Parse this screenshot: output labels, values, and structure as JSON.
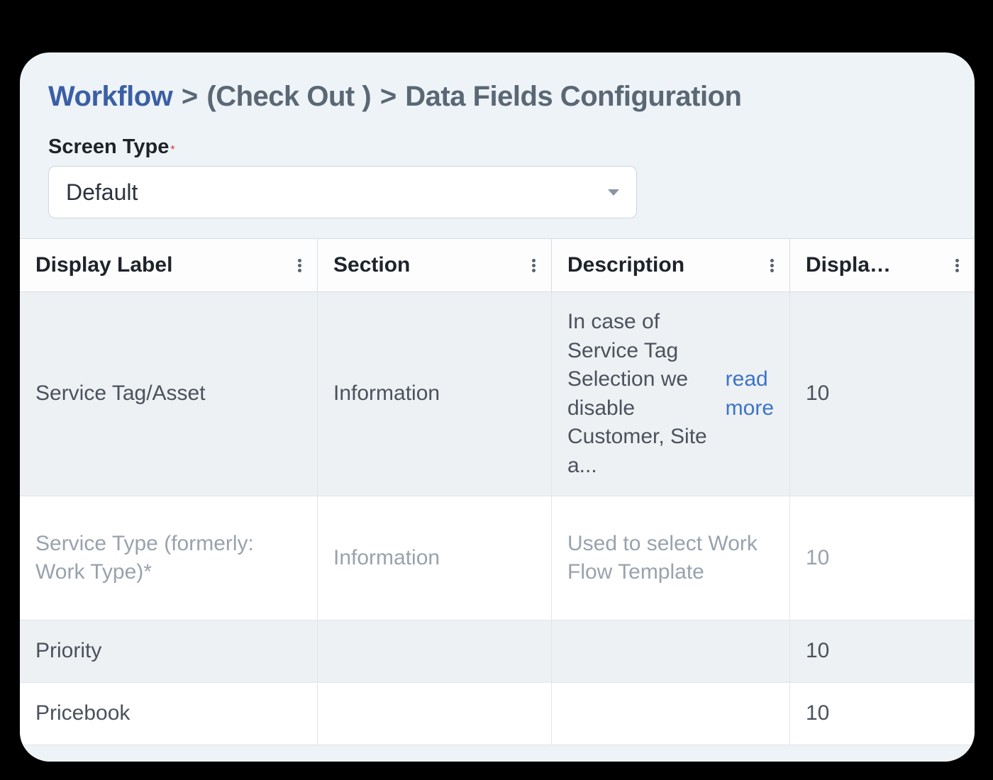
{
  "breadcrumb": {
    "link": "Workflow",
    "sep": ">",
    "mid_prefix": "(",
    "mid_text": "Check Out ",
    "mid_suffix": ")",
    "current": "Data Fields Configuration"
  },
  "screen_type": {
    "label": "Screen Type",
    "required_mark": "*",
    "value": "Default"
  },
  "table": {
    "columns": [
      {
        "label": "Display Label"
      },
      {
        "label": "Section"
      },
      {
        "label": "Description"
      },
      {
        "label": "Displa…"
      }
    ],
    "rows": [
      {
        "display_label": "Service Tag/Asset",
        "section": "Information",
        "description": "In case of Service Tag Selection we disable Customer, Site a... ",
        "read_more": "read more",
        "displa": "10",
        "muted": false,
        "alt": false
      },
      {
        "display_label": "Service Type (formerly: Work Type)*",
        "section": "Information",
        "description": "Used to select Work Flow Template",
        "read_more": "",
        "displa": "10",
        "muted": true,
        "alt": true
      },
      {
        "display_label": "Priority",
        "section": "",
        "description": "",
        "read_more": "",
        "displa": "10",
        "muted": false,
        "alt": false
      },
      {
        "display_label": "Pricebook",
        "section": "",
        "description": "",
        "read_more": "",
        "displa": "10",
        "muted": false,
        "alt": true
      }
    ]
  }
}
